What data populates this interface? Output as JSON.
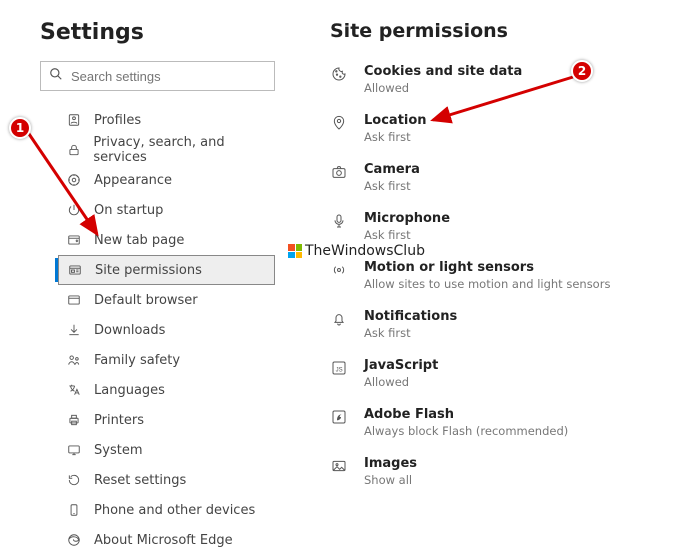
{
  "sidebar": {
    "title": "Settings",
    "search_placeholder": "Search settings",
    "items": [
      {
        "label": "Profiles"
      },
      {
        "label": "Privacy, search, and services"
      },
      {
        "label": "Appearance"
      },
      {
        "label": "On startup"
      },
      {
        "label": "New tab page"
      },
      {
        "label": "Site permissions"
      },
      {
        "label": "Default browser"
      },
      {
        "label": "Downloads"
      },
      {
        "label": "Family safety"
      },
      {
        "label": "Languages"
      },
      {
        "label": "Printers"
      },
      {
        "label": "System"
      },
      {
        "label": "Reset settings"
      },
      {
        "label": "Phone and other devices"
      },
      {
        "label": "About Microsoft Edge"
      }
    ]
  },
  "main": {
    "title": "Site permissions",
    "permissions": [
      {
        "label": "Cookies and site data",
        "sub": "Allowed"
      },
      {
        "label": "Location",
        "sub": "Ask first"
      },
      {
        "label": "Camera",
        "sub": "Ask first"
      },
      {
        "label": "Microphone",
        "sub": "Ask first"
      },
      {
        "label": "Motion or light sensors",
        "sub": "Allow sites to use motion and light sensors"
      },
      {
        "label": "Notifications",
        "sub": "Ask first"
      },
      {
        "label": "JavaScript",
        "sub": "Allowed"
      },
      {
        "label": "Adobe Flash",
        "sub": "Always block Flash (recommended)"
      },
      {
        "label": "Images",
        "sub": "Show all"
      }
    ]
  },
  "annotations": {
    "badge1": "1",
    "badge2": "2"
  },
  "watermark": "TheWindowsClub"
}
